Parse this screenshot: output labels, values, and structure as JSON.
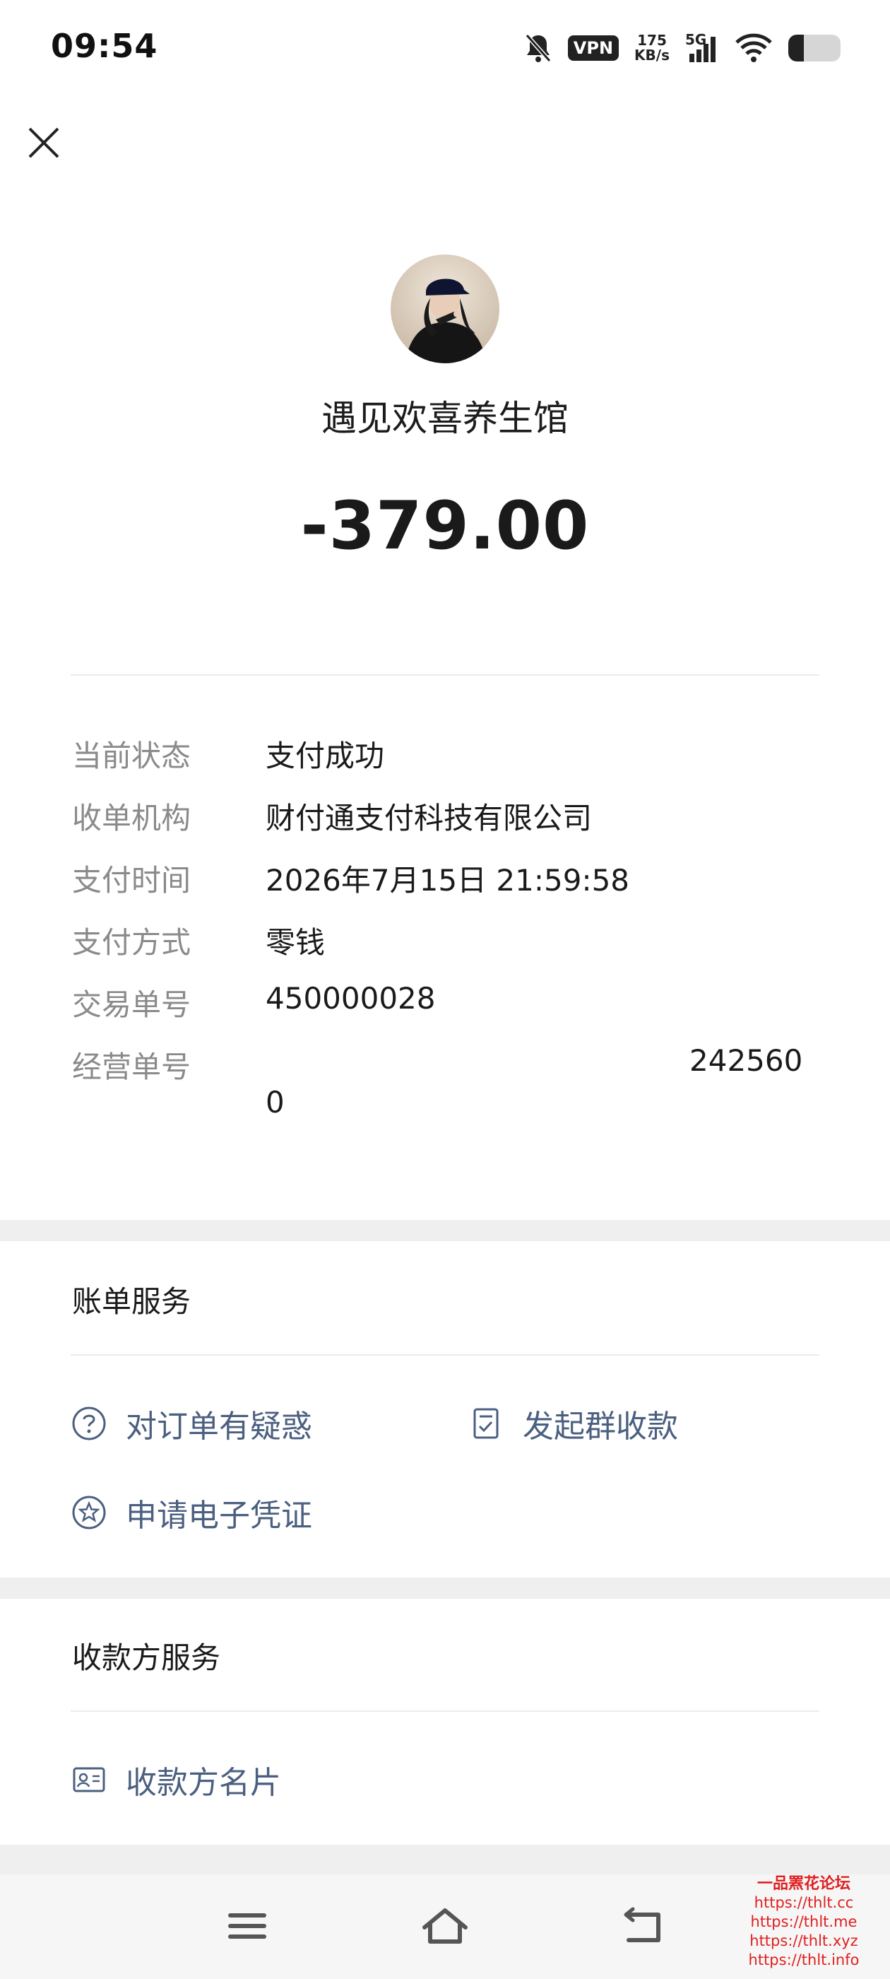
{
  "status_bar": {
    "time": "09:54",
    "vpn_label": "VPN",
    "net_speed_value": "175",
    "net_speed_unit": "KB/s",
    "signal_label": "5G",
    "battery_level": 0.3
  },
  "merchant": {
    "name": "遇见欢喜养生馆"
  },
  "amount": "-379.00",
  "details": [
    {
      "label": "当前状态",
      "value": "支付成功"
    },
    {
      "label": "收单机构",
      "value": "财付通支付科技有限公司"
    },
    {
      "label": "支付时间",
      "value": "2026年7月15日 21:59:58"
    },
    {
      "label": "支付方式",
      "value": "零钱"
    },
    {
      "label": "交易单号",
      "value": "450000028"
    },
    {
      "label": "经营单号",
      "value_suffix": "242560",
      "value_line2": "0"
    }
  ],
  "bill_services": {
    "title": "账单服务",
    "items": [
      {
        "label": "对订单有疑惑",
        "icon": "question-circle-icon"
      },
      {
        "label": "发起群收款",
        "icon": "clipboard-check-icon"
      },
      {
        "label": "申请电子凭证",
        "icon": "star-badge-icon"
      }
    ]
  },
  "payee_services": {
    "title": "收款方服务",
    "items": [
      {
        "label": "收款方名片",
        "icon": "id-card-icon"
      }
    ]
  },
  "nav_bar": {
    "buttons": [
      "menu-icon",
      "home-icon",
      "back-icon"
    ]
  },
  "watermark": {
    "title": "一品罴花论坛",
    "urls": [
      "https://thlt.cc",
      "https://thlt.me",
      "https://thlt.xyz",
      "https://thlt.info"
    ]
  },
  "colors": {
    "link": "#4b5f80",
    "label_gray": "#8a8a8a",
    "band_gray": "#efefef",
    "watermark_red": "#e02020"
  }
}
